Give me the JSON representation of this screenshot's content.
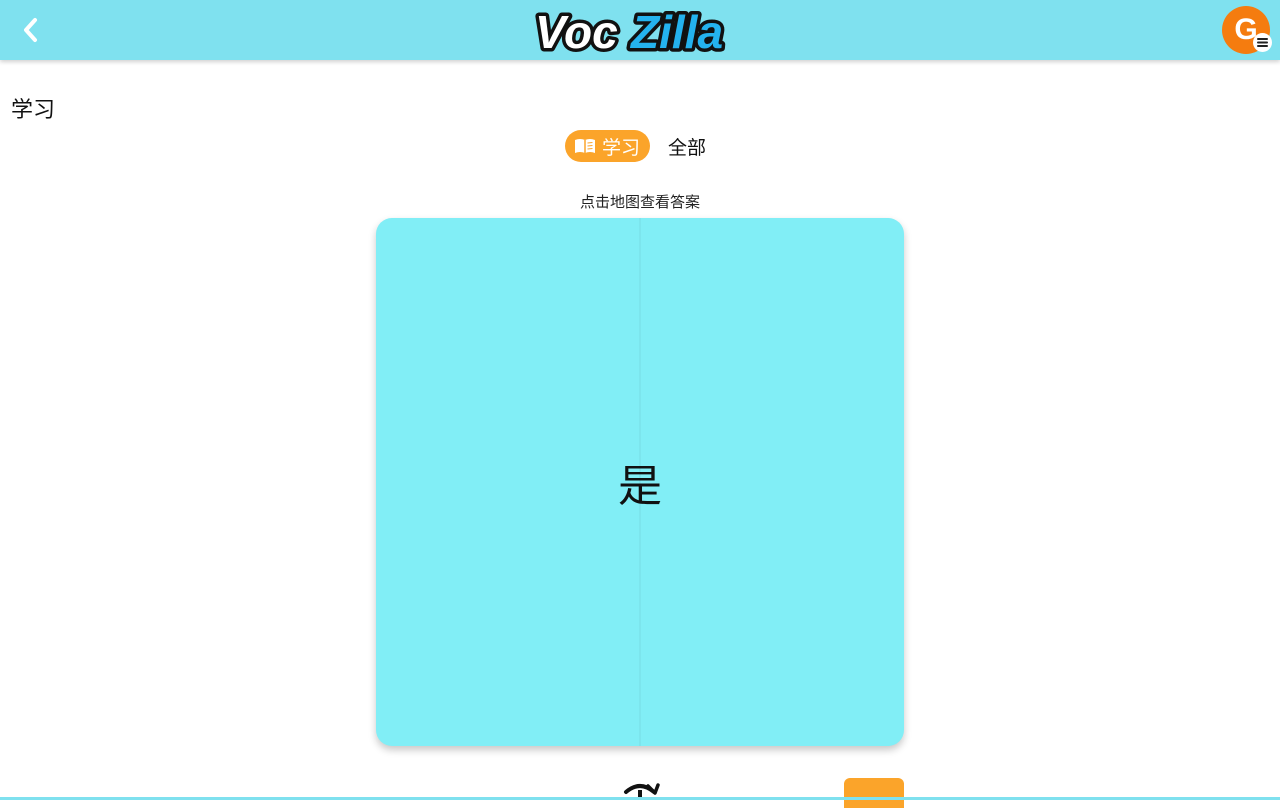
{
  "header": {
    "logo_text_voc": "Voc",
    "logo_text_zilla": "Zilla",
    "avatar_initial": "G",
    "background_color": "#7fe1ef"
  },
  "page": {
    "title": "学习"
  },
  "tabs": [
    {
      "label": "学习",
      "icon": "book-icon",
      "active": true
    },
    {
      "label": "全部",
      "active": false
    }
  ],
  "hint": "点击地图查看答案",
  "card": {
    "word": "是",
    "color": "#81eef6"
  },
  "controls": {
    "flip_icon": "rotate-icon",
    "next_color": "#fba42a"
  },
  "icons": {
    "back": "chevron-left-icon",
    "menu": "menu-icon"
  }
}
